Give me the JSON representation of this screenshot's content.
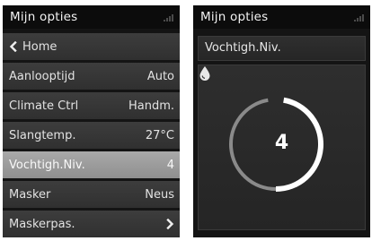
{
  "left_screen": {
    "title": "Mijn opties",
    "menu": [
      {
        "label": "Home",
        "value": "",
        "icon": "chevron-left-icon"
      },
      {
        "label": "Aanlooptijd",
        "value": "Auto"
      },
      {
        "label": "Climate Ctrl",
        "value": "Handm."
      },
      {
        "label": "Slangtemp.",
        "value": "27°C"
      },
      {
        "label": "Vochtigh.Niv.",
        "value": "4",
        "selected": true
      },
      {
        "label": "Masker",
        "value": "Neus"
      },
      {
        "label": "Maskerpas.",
        "value": "",
        "icon": "chevron-right-icon"
      }
    ]
  },
  "right_screen": {
    "title": "Mijn opties",
    "parameter": "Vochtigh.Niv.",
    "value": "4",
    "level": {
      "current": 4,
      "max": 8
    },
    "icon": "water-drop-icon"
  },
  "colors": {
    "selected_row": "#9c9c9c",
    "row": "#363636",
    "background": "#141414"
  }
}
